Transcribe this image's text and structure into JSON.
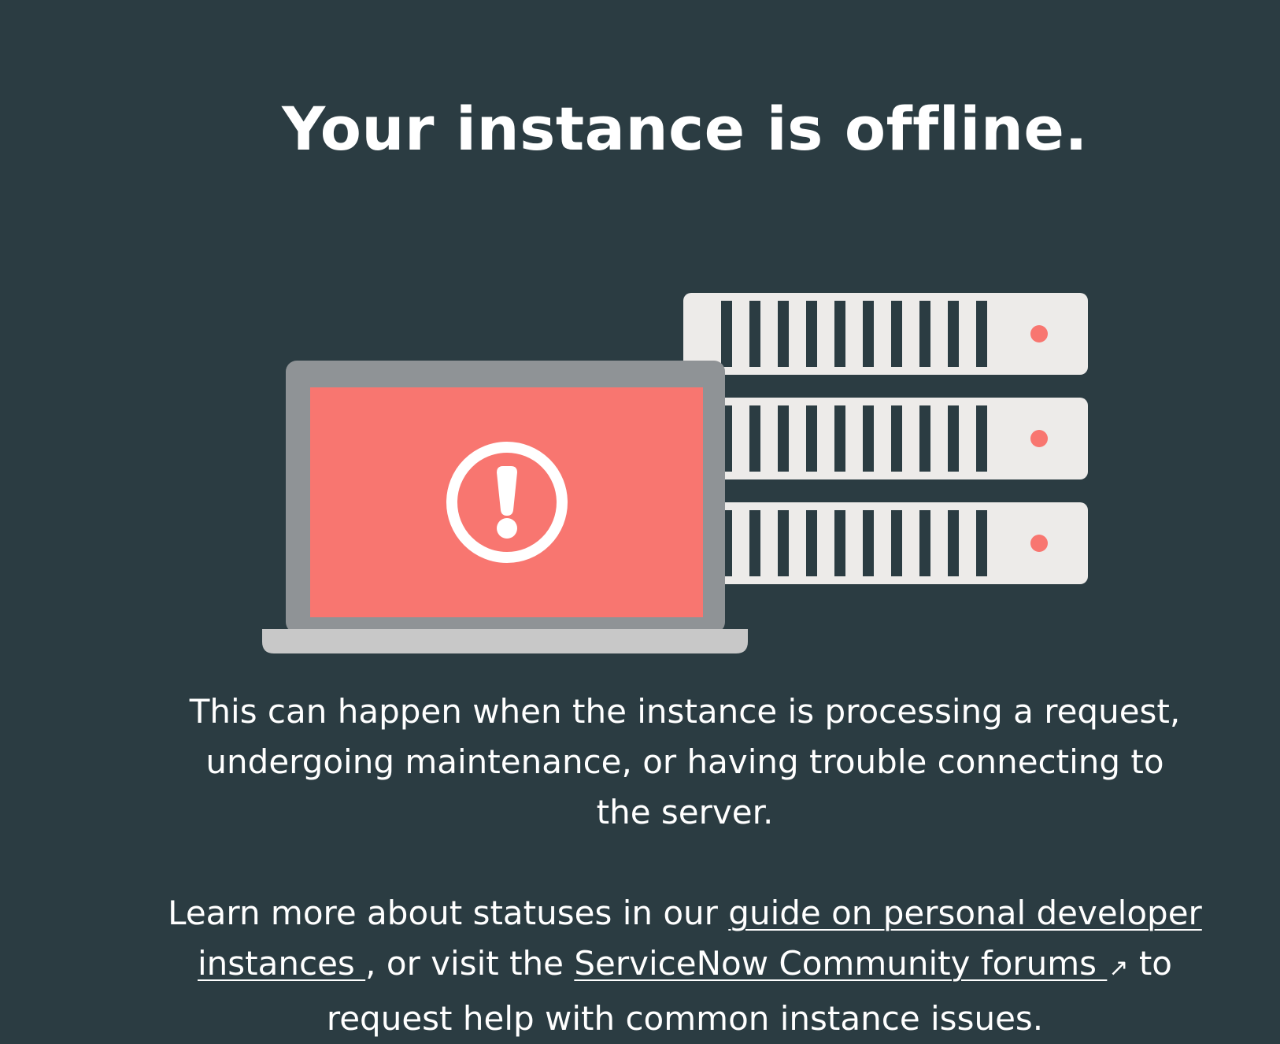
{
  "page": {
    "title": "Your instance is offline.",
    "description": "This can happen when the instance is processing a request, undergoing maintenance, or having trouble connecting to the server.",
    "learn_more": {
      "prefix": "Learn more about statuses in our ",
      "guide_link": "guide on personal developer instances ",
      "middle": ", or visit the ",
      "community_link": "ServiceNow Community forums ",
      "suffix": " to request help with common instance issues."
    }
  },
  "illustration": {
    "laptop_alert_icon": "alert-circle-icon",
    "external_link_icon": "external-link-icon",
    "colors": {
      "background": "#2b3c42",
      "server_body": "#edebe9",
      "server_led": "#f87670",
      "laptop_frame": "#8f9396",
      "laptop_screen": "#f87670",
      "laptop_base": "#c8c8c8",
      "alert_icon": "#ffffff"
    }
  }
}
